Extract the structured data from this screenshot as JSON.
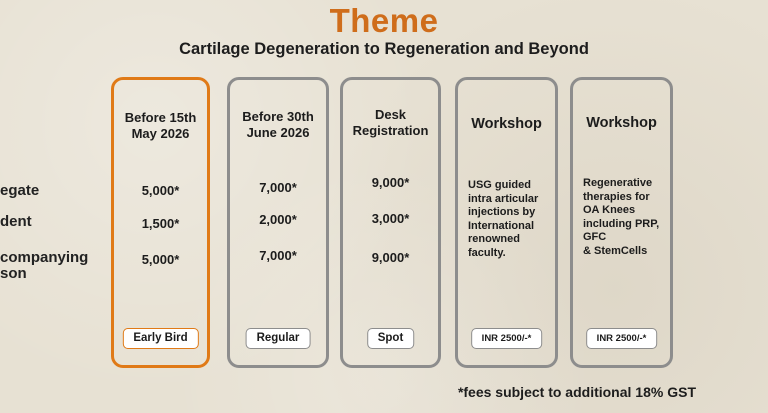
{
  "header": {
    "title": "Theme",
    "subtitle": "Cartilage Degeneration to Regeneration and Beyond"
  },
  "row_labels": [
    "egate",
    "dent",
    "companying\nson"
  ],
  "cards": [
    {
      "head": "Before 15th\nMay 2026",
      "prices": [
        "5,000*",
        "1,500*",
        "5,000*"
      ],
      "tag": "Early Bird"
    },
    {
      "head": "Before 30th\nJune 2026",
      "prices": [
        "7,000*",
        "2,000*",
        "7,000*"
      ],
      "tag": "Regular"
    },
    {
      "head": "Desk\nRegistration",
      "prices": [
        "9,000*",
        "3,000*",
        "9,000*"
      ],
      "tag": "Spot"
    },
    {
      "head": "Workshop",
      "desc": "USG guided\nintra articular\ninjections by\nInternational\nrenowned\nfaculty.",
      "tag": "INR 2500/-*"
    },
    {
      "head": "Workshop",
      "desc": "Regenerative\ntherapies for\nOA Knees\nincluding PRP,\nGFC\n& StemCells",
      "tag": "INR 2500/-*"
    }
  ],
  "footnote": "*fees subject to additional 18% GST",
  "colors": {
    "accent": "#cf6d1b",
    "early_border": "#e07a17",
    "card_border": "#8d8d8d"
  }
}
